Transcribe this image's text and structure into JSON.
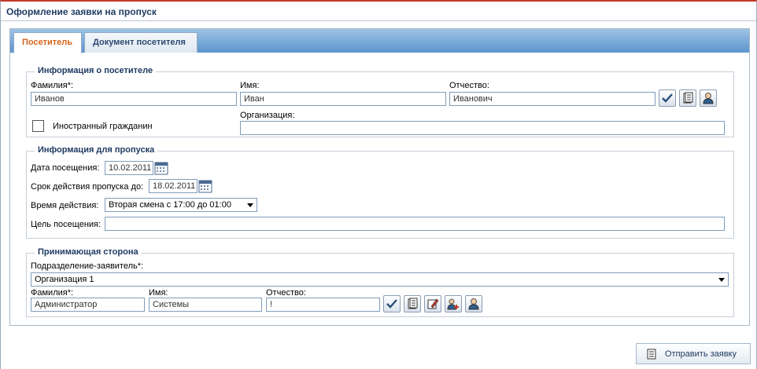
{
  "window": {
    "title": "Оформление заявки на пропуск"
  },
  "tabs": [
    {
      "label": "Посетитель",
      "active": true
    },
    {
      "label": "Документ посетителя",
      "active": false
    }
  ],
  "visitor_info": {
    "legend": "Информация о посетителе",
    "last_name": {
      "label": "Фамилия*:",
      "value": "Иванов"
    },
    "first_name": {
      "label": "Имя:",
      "value": "Иван"
    },
    "patronymic": {
      "label": "Отчество:",
      "value": "Иванович"
    },
    "foreign_citizen": {
      "label": "Иностранный гражданин",
      "checked": false
    },
    "organization": {
      "label": "Организация:",
      "value": ""
    },
    "icons": [
      "check-icon",
      "document-icon",
      "user-icon"
    ]
  },
  "pass_info": {
    "legend": "Информация для пропуска",
    "visit_date": {
      "label": "Дата посещения:",
      "value": "10.02.2011"
    },
    "valid_until": {
      "label": "Срок действия пропуска до:",
      "value": "18.02.2011"
    },
    "time": {
      "label": "Время действия:",
      "value": "Вторая смена с  17:00 до 01:00"
    },
    "purpose": {
      "label": "Цель посещения:",
      "value": ""
    }
  },
  "receiving": {
    "legend": "Принимающая сторона",
    "department": {
      "label": "Подразделение-заявитель*:",
      "value": "Организация 1"
    },
    "last_name": {
      "label": "Фамилия*:",
      "value": "Администратор"
    },
    "first_name": {
      "label": "Имя:",
      "value": "Системы"
    },
    "patronymic": {
      "label": "Отчество:",
      "value": "!"
    },
    "icons": [
      "check-icon",
      "document-icon",
      "edit-icon",
      "add-user-icon",
      "user-icon"
    ]
  },
  "actions": {
    "submit_label": "Отправить заявку"
  },
  "colors": {
    "accent": "#d2641c",
    "title": "#1f3b63",
    "tab_strip": "#5d95cb"
  }
}
